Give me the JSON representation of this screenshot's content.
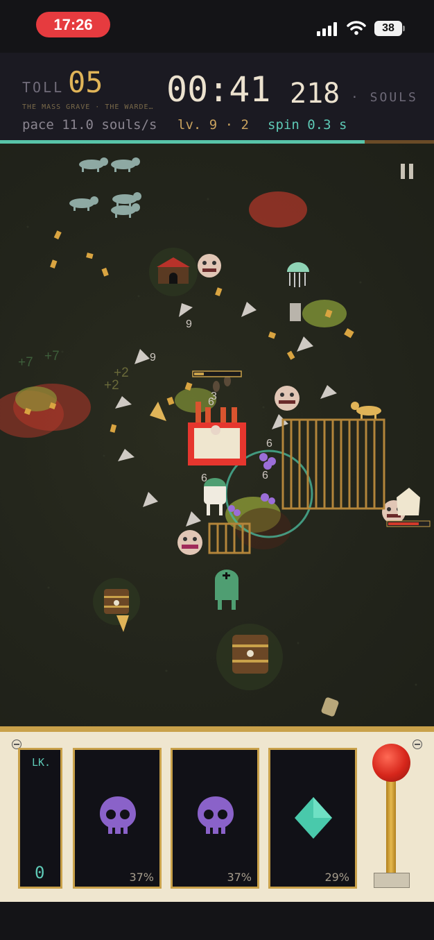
{
  "status_bar": {
    "time": "17:26",
    "battery": "38",
    "icons": [
      "cellular-signal-icon",
      "wifi-icon",
      "battery-icon"
    ]
  },
  "hud": {
    "toll_label": "TOLL",
    "toll_value": "05",
    "subtitle": "THE MASS GRAVE · THE WARDE…",
    "timer": "00:41",
    "souls_count": "218",
    "souls_label": "· SOULS",
    "pace": "pace 11.0 souls/s",
    "level": "lv. 9 · 2",
    "spin": "spin 0.3 s",
    "progress_fraction": 0.84,
    "accent_color": "#e0b458",
    "progress_color": "#58c4a8"
  },
  "field": {
    "floaters": [
      "+7",
      "+7",
      "+2",
      "+2"
    ],
    "damage_numbers": [
      "9",
      "9",
      "6",
      "6",
      "6",
      "6",
      "3"
    ]
  },
  "slot_panel": {
    "lock_label": "LK.",
    "lock_count": "0",
    "reels": [
      {
        "symbol": "skull-icon",
        "percent": "37%",
        "color": "#8a62c9"
      },
      {
        "symbol": "skull-icon",
        "percent": "37%",
        "color": "#8a62c9"
      },
      {
        "symbol": "diamond-icon",
        "percent": "29%",
        "color": "#49c9ab"
      }
    ]
  }
}
